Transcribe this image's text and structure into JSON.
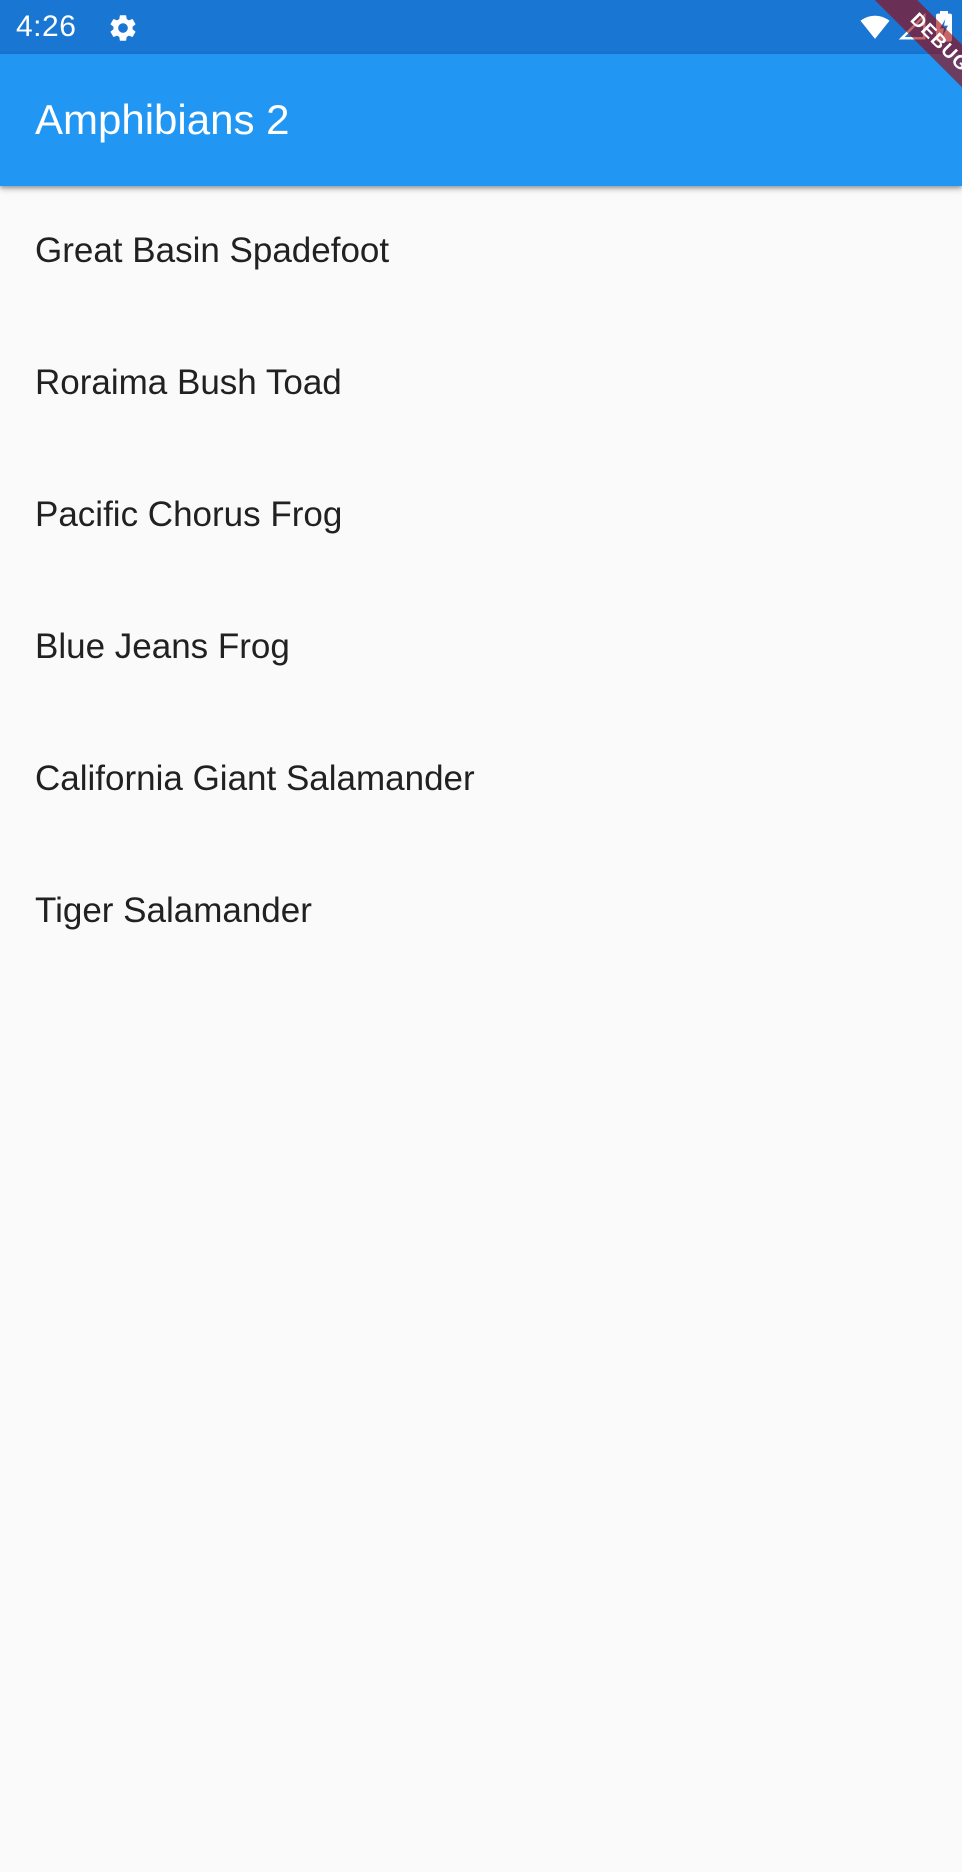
{
  "status_bar": {
    "time": "4:26",
    "left_icon": "gear-icon",
    "right_icons": [
      "wifi-icon",
      "signal-icon",
      "battery-charging-icon"
    ],
    "background_color": "#1976d2"
  },
  "app_bar": {
    "title": "Amphibians 2",
    "background_color": "#2196f3"
  },
  "list": {
    "items": [
      {
        "label": "Great Basin Spadefoot"
      },
      {
        "label": "Roraima Bush Toad"
      },
      {
        "label": "Pacific Chorus Frog"
      },
      {
        "label": "Blue Jeans Frog"
      },
      {
        "label": "California Giant Salamander"
      },
      {
        "label": "Tiger Salamander"
      }
    ]
  },
  "debug_banner": {
    "label": "DEBUG"
  }
}
